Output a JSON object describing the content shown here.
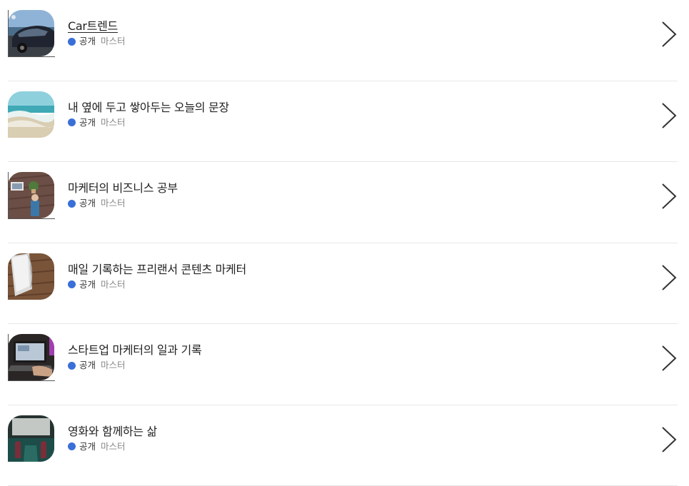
{
  "channels": [
    {
      "title": "Car트렌드",
      "visibility": "공개",
      "role": "마스터",
      "thumbnail_icon": "car-photo",
      "underlined": true
    },
    {
      "title": "내 옆에 두고 쌓아두는 오늘의 문장",
      "visibility": "공개",
      "role": "마스터",
      "thumbnail_icon": "beach-wave-photo",
      "underlined": false
    },
    {
      "title": "마케터의 비즈니스 공부",
      "visibility": "공개",
      "role": "마스터",
      "thumbnail_icon": "desk-workspace-photo",
      "underlined": false
    },
    {
      "title": "매일 기록하는 프리랜서 콘텐츠 마케터",
      "visibility": "공개",
      "role": "마스터",
      "thumbnail_icon": "notebook-photo",
      "underlined": false
    },
    {
      "title": "스타트업 마케터의 일과 기록",
      "visibility": "공개",
      "role": "마스터",
      "thumbnail_icon": "laptop-photo",
      "underlined": false
    },
    {
      "title": "영화와 함께하는 삶",
      "visibility": "공개",
      "role": "마스터",
      "thumbnail_icon": "movie-theater-photo",
      "underlined": false
    }
  ],
  "colors": {
    "status_dot": "#3a6fd8",
    "divider": "#e8e8e8",
    "chevron": "#333333"
  }
}
